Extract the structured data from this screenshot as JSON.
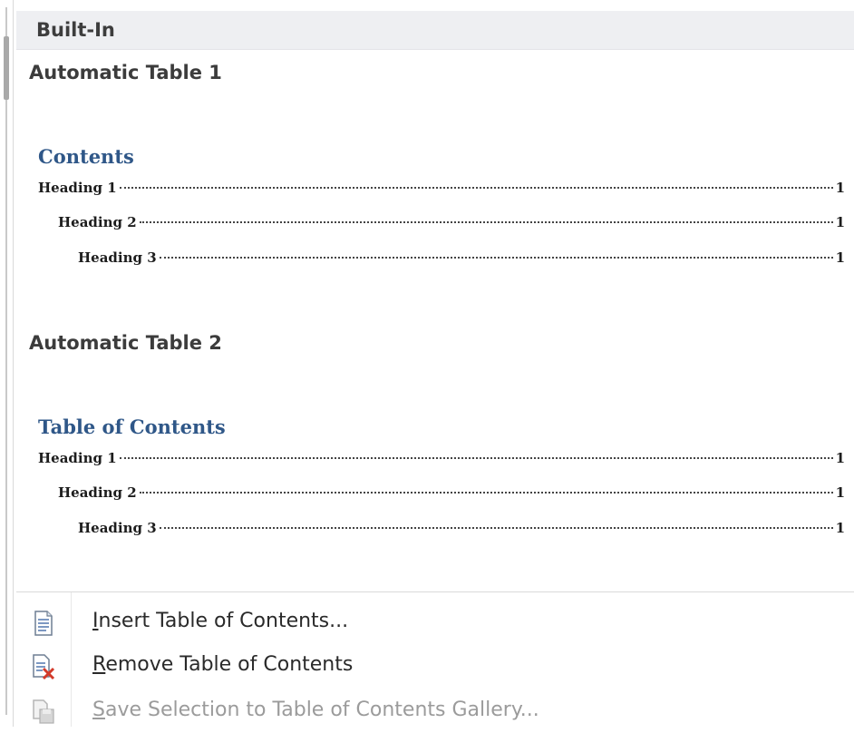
{
  "section_header": "Built-In",
  "gallery": [
    {
      "title": "Automatic Table 1",
      "toc_heading": "Contents",
      "entries": [
        {
          "label": "Heading 1",
          "page": "1"
        },
        {
          "label": "Heading 2",
          "page": "1"
        },
        {
          "label": "Heading 3",
          "page": "1"
        }
      ]
    },
    {
      "title": "Automatic Table 2",
      "toc_heading": "Table of Contents",
      "entries": [
        {
          "label": "Heading 1",
          "page": "1"
        },
        {
          "label": "Heading 2",
          "page": "1"
        },
        {
          "label": "Heading 3",
          "page": "1"
        }
      ]
    }
  ],
  "menu": [
    {
      "first": "I",
      "rest": "nsert Table of Contents...",
      "icon": "document-icon",
      "enabled": true
    },
    {
      "first": "R",
      "rest": "emove Table of Contents",
      "icon": "remove-document-icon",
      "enabled": true
    },
    {
      "first": "S",
      "rest": "ave Selection to Table of Contents Gallery...",
      "icon": "save-selection-icon",
      "enabled": false
    }
  ],
  "colors": {
    "toc_heading": "#2f5788",
    "header_bg": "#eeeff2",
    "remove_x": "#d23a2a"
  }
}
